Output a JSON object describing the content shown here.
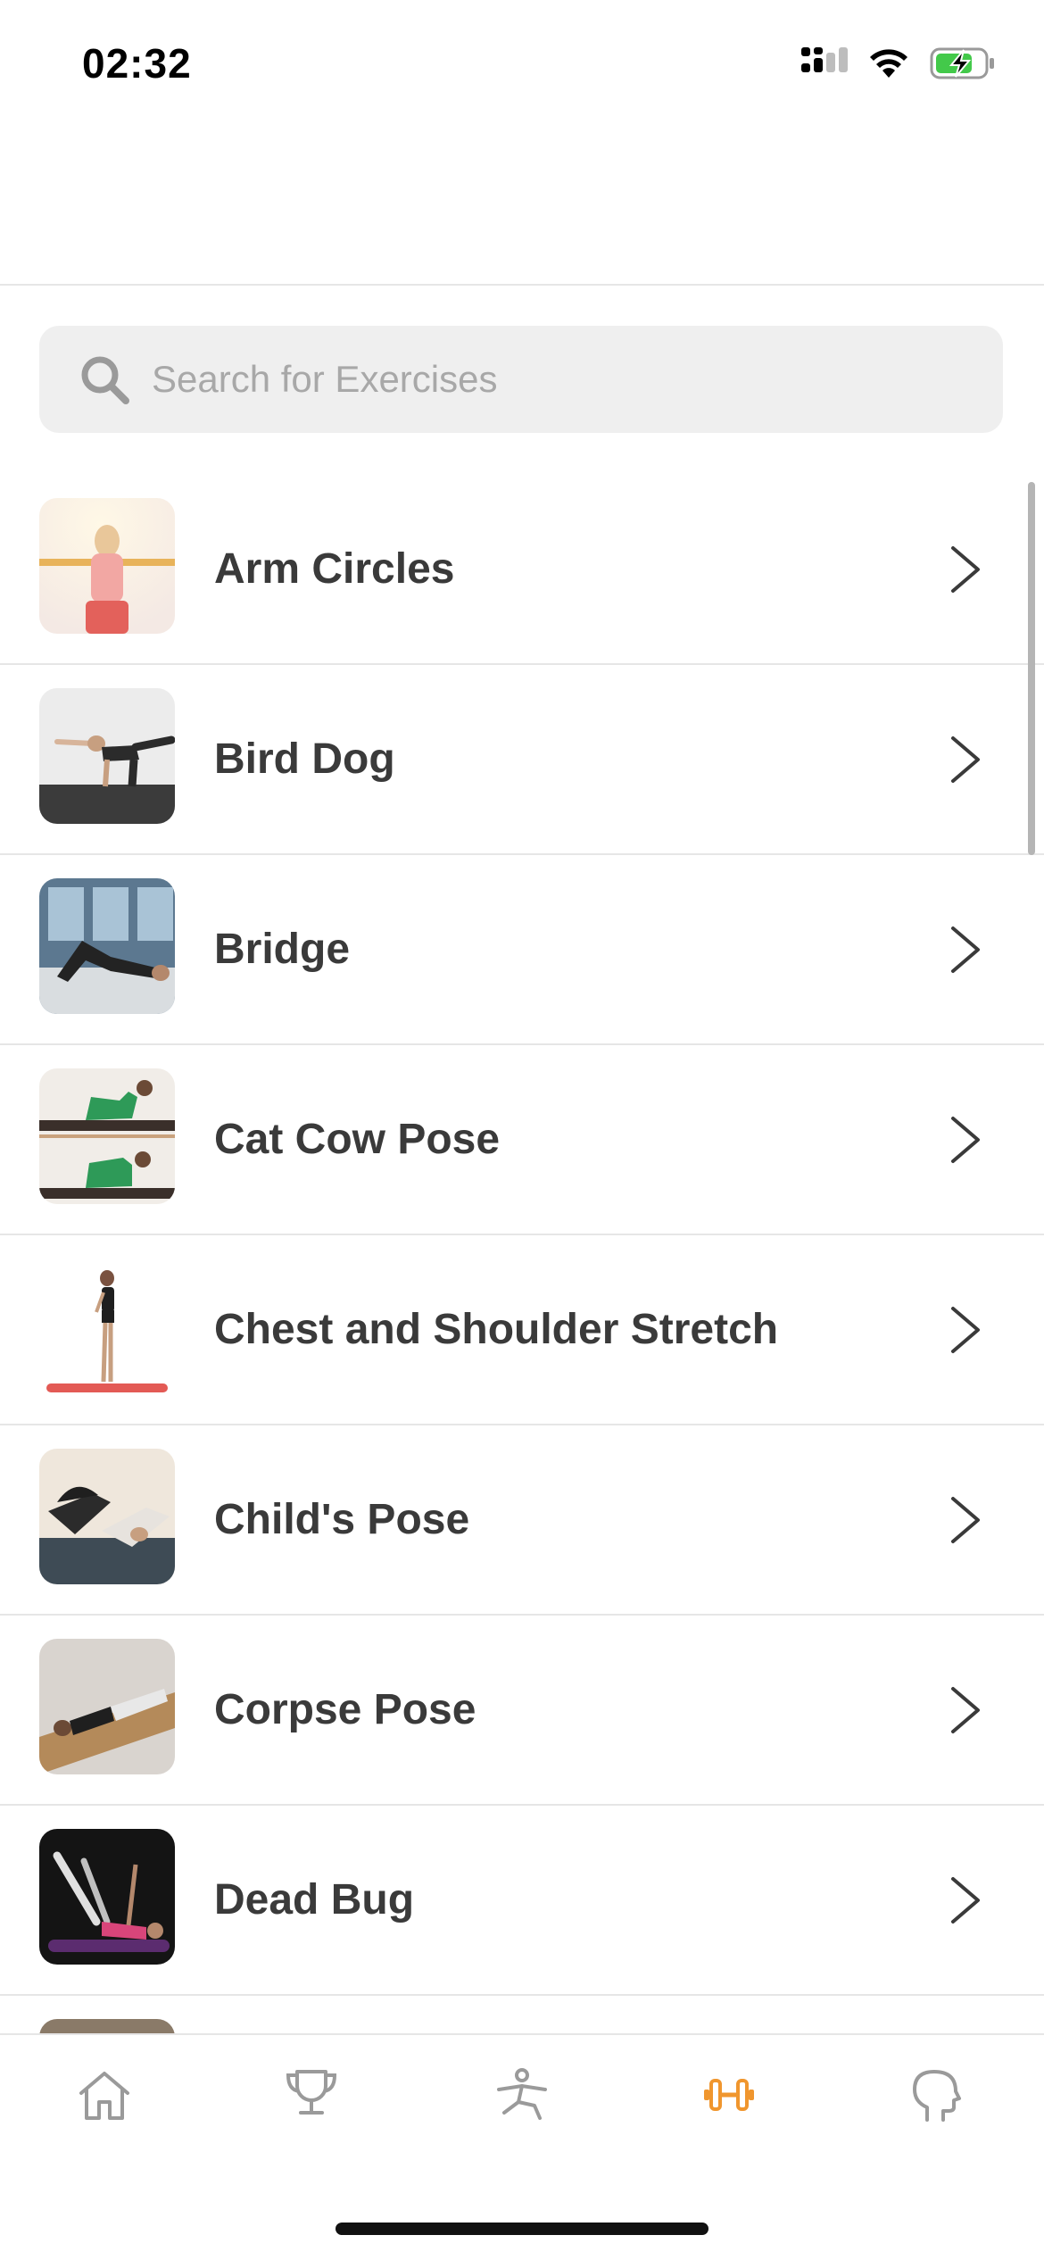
{
  "status_bar": {
    "time": "02:32"
  },
  "search": {
    "placeholder": "Search for Exercises"
  },
  "exercises": [
    {
      "label": "Arm Circles"
    },
    {
      "label": "Bird Dog"
    },
    {
      "label": "Bridge"
    },
    {
      "label": "Cat Cow Pose"
    },
    {
      "label": "Chest and Shoulder Stretch"
    },
    {
      "label": "Child's Pose"
    },
    {
      "label": "Corpse Pose"
    },
    {
      "label": "Dead Bug"
    }
  ],
  "tabbar": {
    "items": [
      {
        "icon": "home-icon",
        "active": false
      },
      {
        "icon": "trophy-icon",
        "active": false
      },
      {
        "icon": "stretch-figure-icon",
        "active": false
      },
      {
        "icon": "dumbbell-icon",
        "active": true
      },
      {
        "icon": "head-icon",
        "active": false
      }
    ]
  },
  "colors": {
    "accent": "#f0962e",
    "inactive_icon": "#9a9a9a",
    "search_bg": "#efefef"
  }
}
